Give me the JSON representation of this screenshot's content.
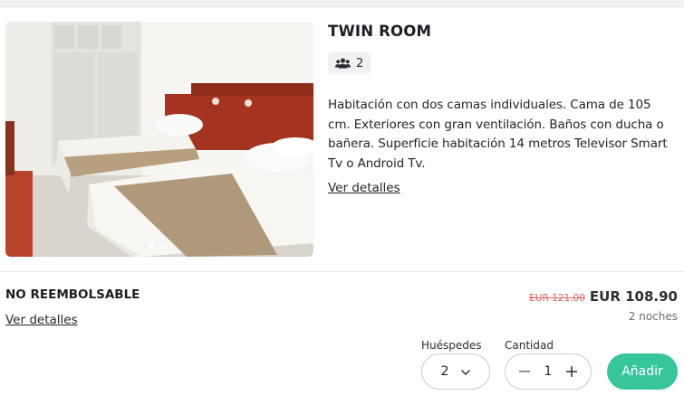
{
  "room": {
    "title": "TWIN ROOM",
    "guests_count": "2",
    "guests_icon": "users-icon",
    "description": "Habitación con dos camas individuales. Cama de 105 cm. Exteriores  con gran ventilación. Baños con ducha o bañera. Superficie habitación 14 metros Televisor Smart Tv o Android Tv.",
    "details_link": "Ver detalles",
    "photo_icon": "room-photo"
  },
  "rate": {
    "name": "NO REEMBOLSABLE",
    "details_link": "Ver detalles",
    "old_price": "EUR 121.00",
    "new_price": "EUR 108.90",
    "nights": "2 noches"
  },
  "booking": {
    "guests_label": "Huéspedes",
    "guests_value": "2",
    "quantity_label": "Cantidad",
    "quantity_value": "1",
    "add_label": "Añadir"
  },
  "colors": {
    "accent": "#37c59c",
    "old_price": "#e0605f"
  }
}
